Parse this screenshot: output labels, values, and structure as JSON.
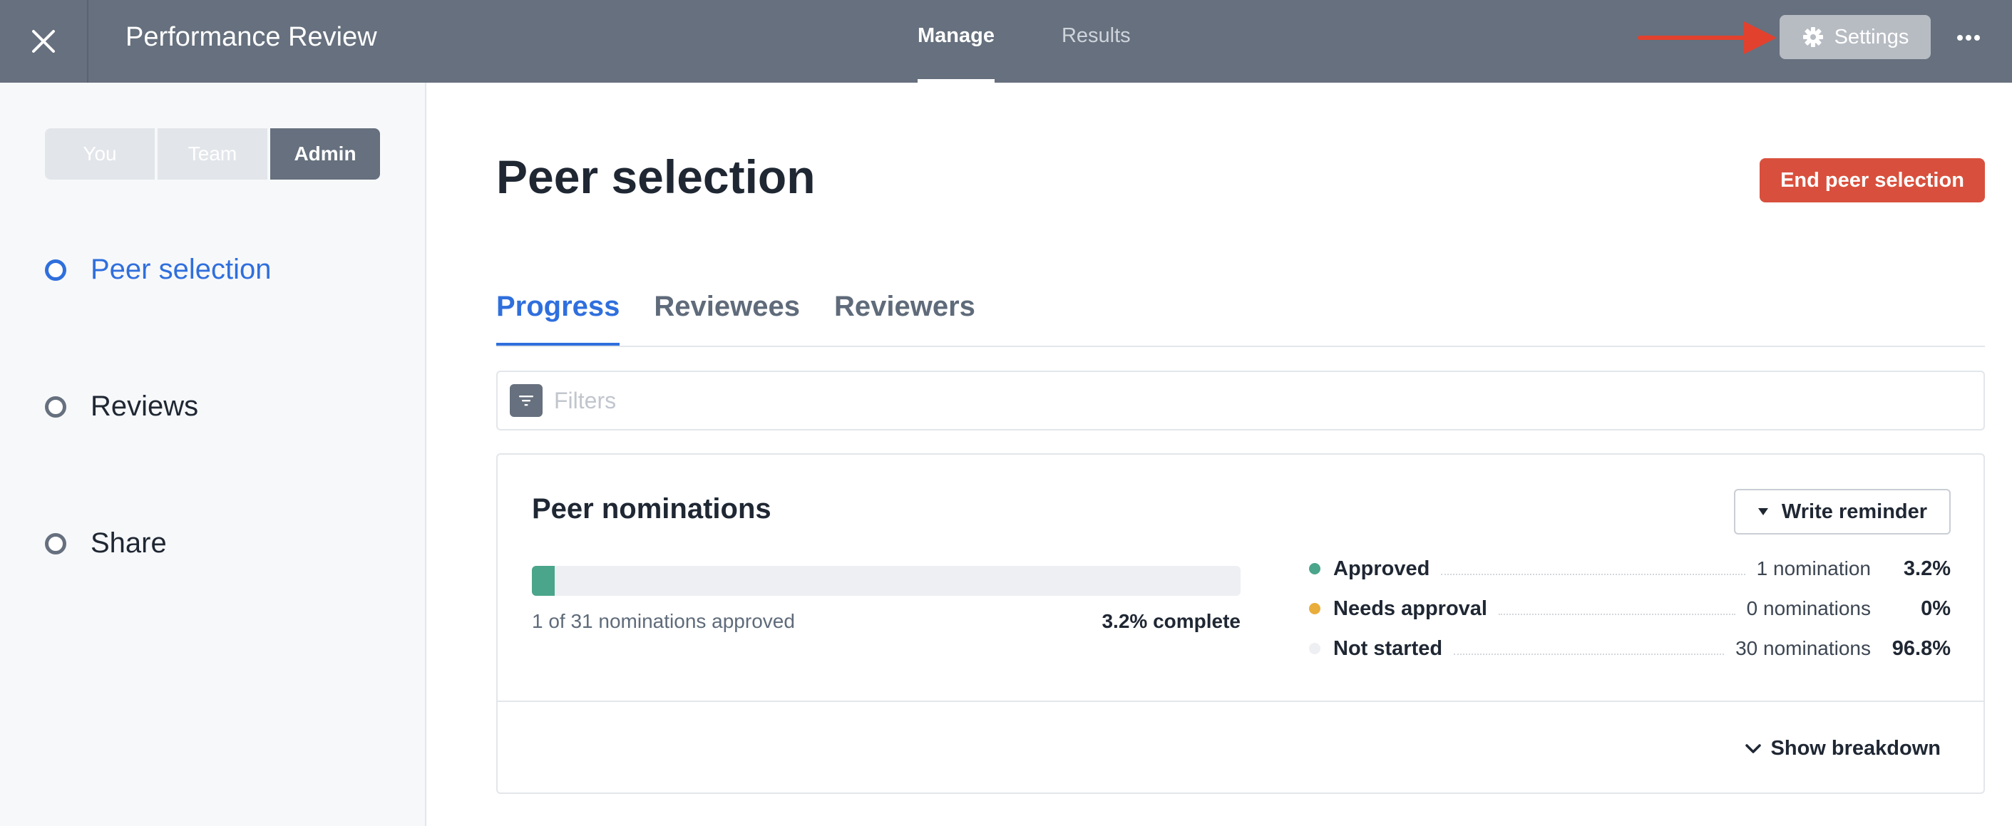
{
  "topbar": {
    "app_title": "Performance Review",
    "tabs": [
      {
        "label": "Manage",
        "active": true
      },
      {
        "label": "Results",
        "active": false
      }
    ],
    "settings_label": "Settings",
    "annotation_arrow_color": "#e2412e"
  },
  "sidebar": {
    "segments": [
      {
        "label": "You",
        "active": false
      },
      {
        "label": "Team",
        "active": false
      },
      {
        "label": "Admin",
        "active": true
      }
    ],
    "steps": [
      {
        "label": "Peer selection",
        "active": true
      },
      {
        "label": "Reviews",
        "active": false
      },
      {
        "label": "Share",
        "active": false
      }
    ]
  },
  "main": {
    "title": "Peer selection",
    "end_button_label": "End peer selection",
    "tabs": [
      {
        "label": "Progress",
        "active": true
      },
      {
        "label": "Reviewees",
        "active": false
      },
      {
        "label": "Reviewers",
        "active": false
      }
    ],
    "filter_placeholder": "Filters",
    "card": {
      "title": "Peer nominations",
      "reminder_label": "Write reminder",
      "progress_fraction": 0.032,
      "progress_caption": "1 of 31 nominations approved",
      "progress_complete": "3.2% complete",
      "stats": [
        {
          "label": "Approved",
          "count": "1 nomination",
          "percent": "3.2%",
          "color": "#4aa58a"
        },
        {
          "label": "Needs approval",
          "count": "0 nominations",
          "percent": "0%",
          "color": "#e9ad3c"
        },
        {
          "label": "Not started",
          "count": "30 nominations",
          "percent": "96.8%",
          "color": "#eeeff2"
        }
      ],
      "breakdown_label": "Show breakdown"
    }
  },
  "colors": {
    "topbar_bg": "#66707e",
    "accent_blue": "#2f6fdd",
    "danger": "#d8503d",
    "progress_green": "#4aa58a"
  }
}
